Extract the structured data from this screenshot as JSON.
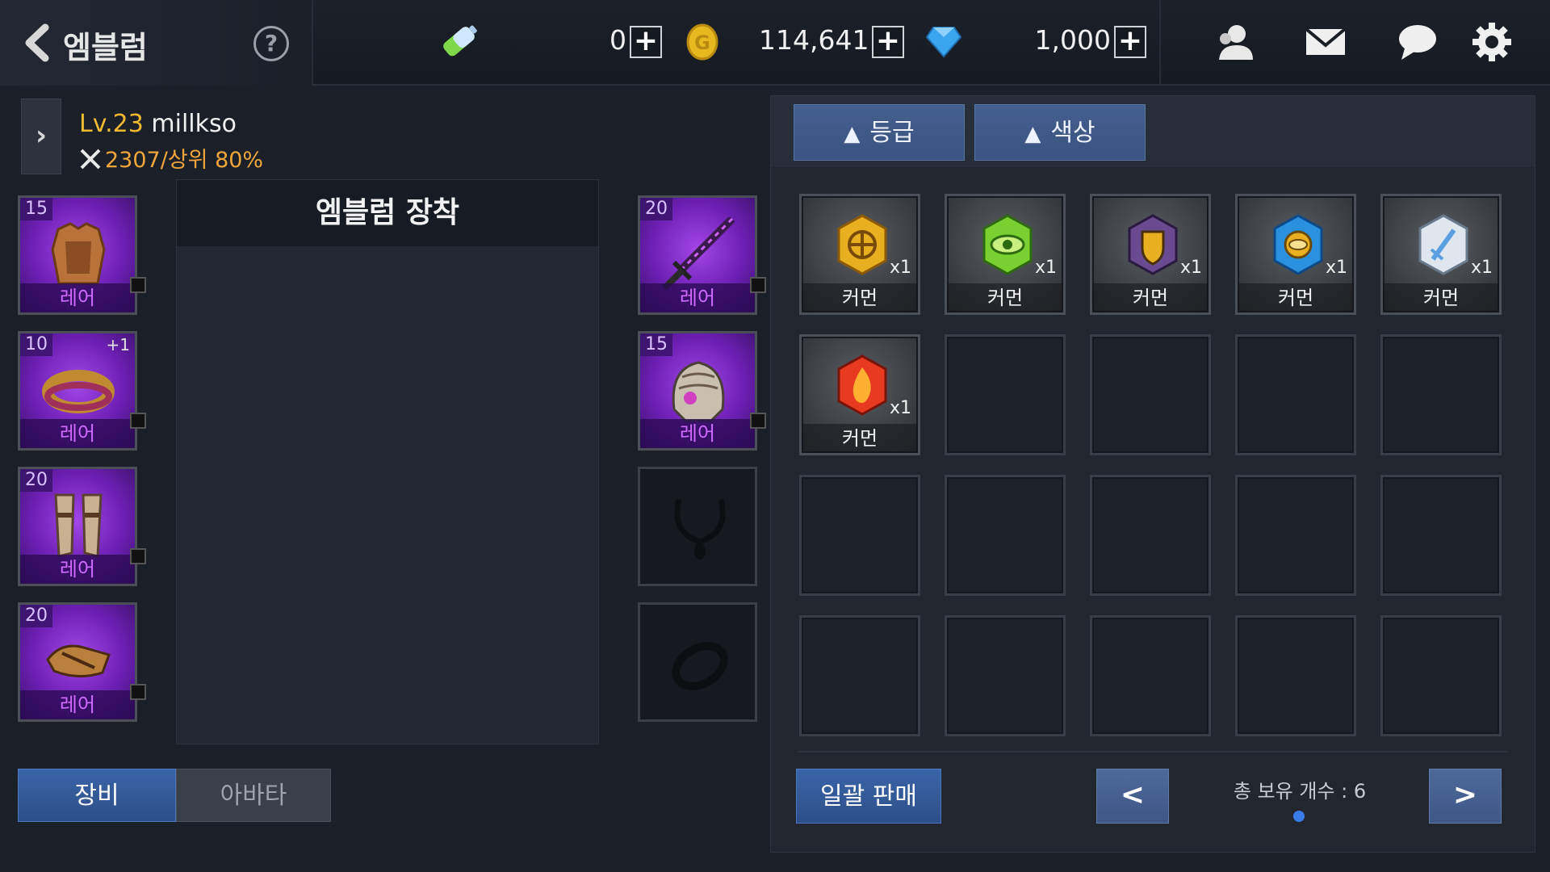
{
  "header": {
    "title": "엠블럼",
    "help_label": "?",
    "resources": [
      {
        "name": "battery-icon",
        "value": "0"
      },
      {
        "name": "coin-icon",
        "value": "114,641"
      },
      {
        "name": "gem-icon",
        "value": "1,000"
      }
    ],
    "plus_label": "+",
    "right_icons": [
      "friends-icon",
      "mail-icon",
      "chat-icon",
      "settings-icon"
    ]
  },
  "character": {
    "level": "Lv.23",
    "name": "millkso",
    "power": "2307",
    "rank": "/상위 80%"
  },
  "equip_left": [
    {
      "level": "15",
      "grade": "레어",
      "item": "armor",
      "plus": ""
    },
    {
      "level": "10",
      "grade": "레어",
      "item": "belt",
      "plus": "+1"
    },
    {
      "level": "20",
      "grade": "레어",
      "item": "greaves",
      "plus": ""
    },
    {
      "level": "20",
      "grade": "레어",
      "item": "gloves",
      "plus": ""
    }
  ],
  "equip_right": [
    {
      "level": "20",
      "grade": "레어",
      "item": "sword"
    },
    {
      "level": "15",
      "grade": "레어",
      "item": "helmet"
    },
    {
      "item": "necklace-empty"
    },
    {
      "item": "ring-empty"
    }
  ],
  "emblem_panel": {
    "title": "엠블럼 장착"
  },
  "tabs": {
    "equip": "장비",
    "avatar": "아바타"
  },
  "inventory": {
    "sort_buttons": [
      {
        "arrow": "▲",
        "label": "등급"
      },
      {
        "arrow": "▲",
        "label": "색상"
      }
    ],
    "items": [
      {
        "gem": "gold-cross-emblem",
        "qty": "x1",
        "grade": "커먼"
      },
      {
        "gem": "green-eye-emblem",
        "qty": "x1",
        "grade": "커먼"
      },
      {
        "gem": "purple-shield-emblem",
        "qty": "x1",
        "grade": "커먼"
      },
      {
        "gem": "blue-eye-emblem",
        "qty": "x1",
        "grade": "커먼"
      },
      {
        "gem": "white-sword-emblem",
        "qty": "x1",
        "grade": "커먼"
      },
      {
        "gem": "red-fire-emblem",
        "qty": "x1",
        "grade": "커먼"
      }
    ],
    "sell_label": "일괄 판매",
    "total_label": "총 보유 개수 : 6",
    "prev_label": "<",
    "next_label": ">"
  },
  "colors": {
    "rare_purple": "#7a2bc8",
    "level_gold": "#f0b930",
    "power_orange": "#f0a53a",
    "button_blue": "#3a64a8"
  }
}
